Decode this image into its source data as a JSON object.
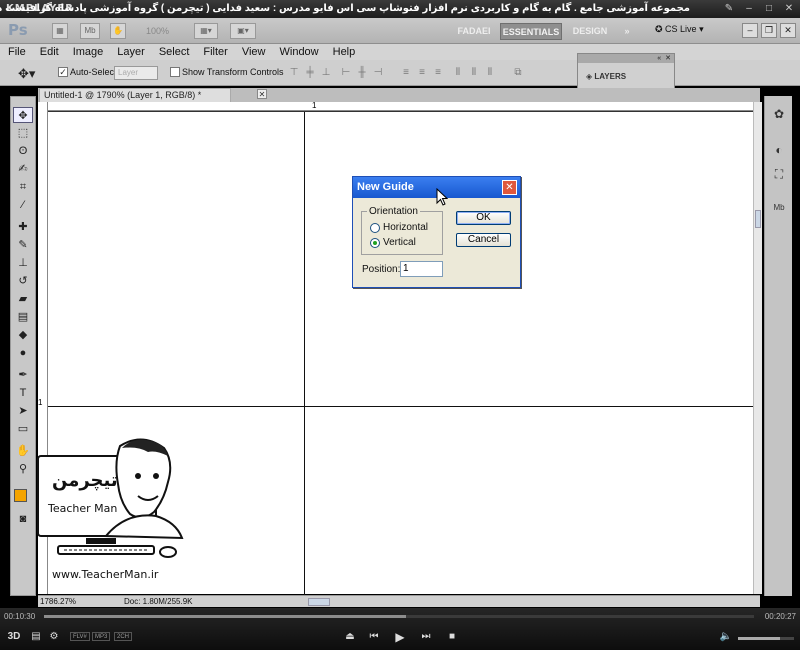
{
  "player": {
    "logo": "KMPLAYER",
    "video_title": "مجموعه آموزشی جامع . گام به گام و کاربردی نرم افزار فتوشاپ سی اس فایو  مدرس : سعید فدایی ( تیچرمن ) گروه آموزشی پادشاه گرافیست ها",
    "time_elapsed": "00:10:30",
    "time_total": "00:20:27",
    "progress": 0.51,
    "volume": 0.75,
    "badges": [
      "FLV#",
      "MP3",
      "2CH"
    ]
  },
  "photoshop": {
    "zoom_value": "100%",
    "workspaces": [
      "FADAEI",
      "ESSENTIALS",
      "DESIGN",
      "»"
    ],
    "cs_live": "CS Live",
    "menu": [
      "File",
      "Edit",
      "Image",
      "Layer",
      "Select",
      "Filter",
      "View",
      "Window",
      "Help"
    ],
    "options": {
      "auto_select_label": "Auto-Select:",
      "auto_select_value": "Layer",
      "show_transform_label": "Show Transform Controls"
    },
    "layers_panel_title": "LAYERS",
    "document_tab": "Untitled-1 @ 1790% (Layer 1, RGB/8) *",
    "ruler_top_number": "1",
    "ruler_left_number": "1",
    "status": {
      "zoom": "1786.27%",
      "doc": "Doc: 1.80M/255.9K"
    }
  },
  "dialog": {
    "title": "New Guide",
    "orientation_legend": "Orientation",
    "horizontal_label": "Horizontal",
    "vertical_label": "Vertical",
    "selected": "Vertical",
    "ok_label": "OK",
    "cancel_label": "Cancel",
    "position_label": "Position:",
    "position_value": "1"
  },
  "watermark": {
    "brand": "Teacher Man",
    "site": "www.TeacherMan.ir"
  },
  "colors": {
    "foreground": "#f4a400",
    "dialog_title": "#1757cf"
  }
}
